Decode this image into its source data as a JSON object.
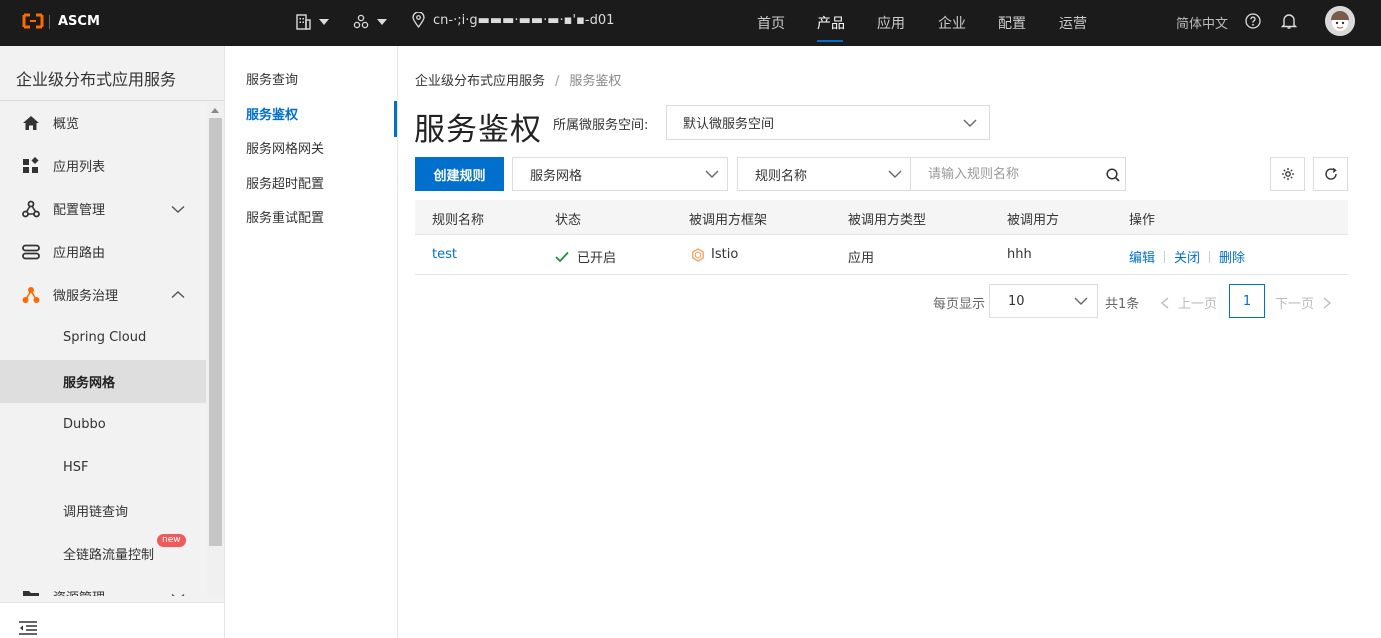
{
  "topbar": {
    "brand": "ASCM",
    "region": "cn-·;i·g▬▬▬·▬▬·▬·▪'▪-d01",
    "nav": [
      "首页",
      "产品",
      "应用",
      "企业",
      "配置",
      "运营"
    ],
    "active_nav": "产品",
    "language": "简体中文",
    "accent_color": "#0070cc"
  },
  "sidebar": {
    "title": "企业级分布式应用服务",
    "items": [
      {
        "label": "概览",
        "icon": "home-icon"
      },
      {
        "label": "应用列表",
        "icon": "app-grid-icon"
      },
      {
        "label": "配置管理",
        "icon": "config-icon",
        "expandable": true
      },
      {
        "label": "应用路由",
        "icon": "route-icon"
      },
      {
        "label": "微服务治理",
        "icon": "microservice-icon",
        "expanded": true
      },
      {
        "label": "Spring Cloud"
      },
      {
        "label": "服务网格",
        "selected": true
      },
      {
        "label": "Dubbo"
      },
      {
        "label": "HSF"
      },
      {
        "label": "调用链查询"
      },
      {
        "label": "全链路流量控制",
        "badge": "new"
      },
      {
        "label": "资源管理",
        "icon": "folder-icon",
        "expandable": true
      }
    ]
  },
  "submenu": {
    "items": [
      "服务查询",
      "服务鉴权",
      "服务网格网关",
      "服务超时配置",
      "服务重试配置"
    ],
    "active": "服务鉴权"
  },
  "main": {
    "breadcrumb": [
      "企业级分布式应用服务",
      "服务鉴权"
    ],
    "title": "服务鉴权",
    "namespace_label": "所属微服务空间:",
    "namespace_value": "默认微服务空间",
    "create_button": "创建规则",
    "filter_type": "服务网格",
    "filter_field": "规则名称",
    "search_placeholder": "请输入规则名称",
    "table": {
      "headers": [
        "规则名称",
        "状态",
        "被调用方框架",
        "被调用方类型",
        "被调用方",
        "操作"
      ],
      "rows": [
        {
          "name": "test",
          "status": "已开启",
          "framework": "Istio",
          "type": "应用",
          "callee": "hhh",
          "actions": [
            "编辑",
            "关闭",
            "删除"
          ]
        }
      ]
    },
    "pagination": {
      "page_size_label": "每页显示",
      "page_size": "10",
      "total": "共1条",
      "prev": "上一页",
      "current": "1",
      "next": "下一页"
    }
  }
}
